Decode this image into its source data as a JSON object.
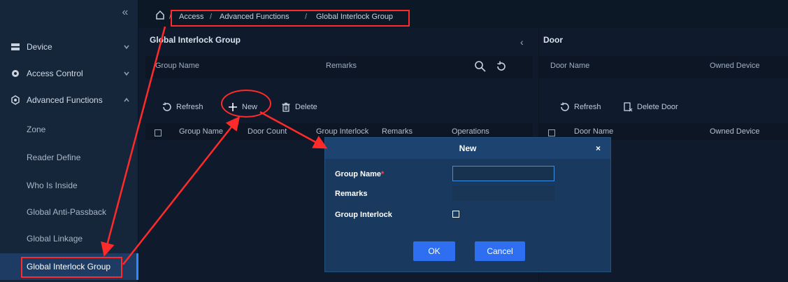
{
  "sidebar": {
    "items": [
      {
        "label": "Device"
      },
      {
        "label": "Access Control"
      },
      {
        "label": "Advanced Functions"
      }
    ],
    "sub_items": [
      {
        "label": "Zone"
      },
      {
        "label": "Reader Define"
      },
      {
        "label": "Who Is Inside"
      },
      {
        "label": "Global Anti-Passback"
      },
      {
        "label": "Global Linkage"
      },
      {
        "label": "Global Interlock Group"
      }
    ]
  },
  "breadcrumb": {
    "items": [
      "Access",
      "Advanced Functions",
      "Global Interlock Group"
    ],
    "separator": "/"
  },
  "left_panel": {
    "title": "Global Interlock Group",
    "search_headers": [
      "Group Name",
      "Remarks"
    ],
    "toolbar": {
      "refresh": "Refresh",
      "new": "New",
      "delete": "Delete"
    },
    "table_headers": [
      "Group Name",
      "Door Count",
      "Group Interlock",
      "Remarks",
      "Operations"
    ]
  },
  "right_panel": {
    "title": "Door",
    "search_headers": [
      "Door Name",
      "Owned Device"
    ],
    "toolbar": {
      "refresh": "Refresh",
      "delete_door": "Delete Door"
    },
    "table_headers": [
      "Door Name",
      "Owned Device"
    ]
  },
  "modal": {
    "title": "New",
    "close": "×",
    "fields": [
      {
        "label": "Group Name",
        "required": "*"
      },
      {
        "label": "Remarks"
      },
      {
        "label": "Group Interlock"
      }
    ],
    "ok": "OK",
    "cancel": "Cancel"
  },
  "colors": {
    "accent": "#2d6ff0",
    "annotation": "#ff2a2a",
    "sidebar_active": "#1d3b63"
  }
}
